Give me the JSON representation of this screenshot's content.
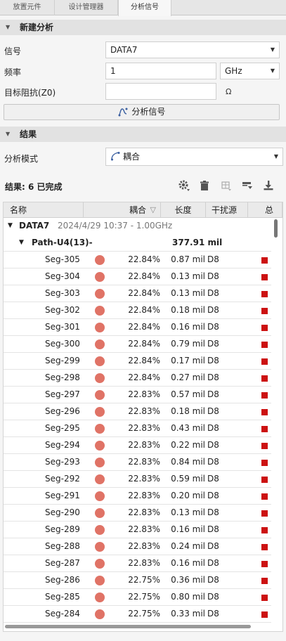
{
  "tabs": [
    "放置元件",
    "设计管理器",
    "分析信号"
  ],
  "new_analysis": {
    "header": "新建分析",
    "signal_label": "信号",
    "signal_value": "DATA7",
    "freq_label": "频率",
    "freq_value": "1",
    "freq_unit": "GHz",
    "impedance_label": "目标阻抗(Z0)",
    "impedance_value": "",
    "impedance_unit": "Ω",
    "analyze_button": "分析信号"
  },
  "results_section": {
    "header": "结果",
    "mode_label": "分析模式",
    "mode_value": "耦合",
    "summary": "结果: 6 已完成"
  },
  "grid": {
    "columns": [
      "名称",
      "耦合",
      "长度",
      "干扰源",
      "总"
    ],
    "group": {
      "name": "DATA7",
      "meta": "2024/4/29 10:37 - 1.00GHz"
    },
    "path": {
      "name": "Path-U4(13)-",
      "length": "377.91 mil"
    },
    "rows": [
      {
        "name": "Seg-305",
        "coupling": "22.84%",
        "length": "0.87 mil",
        "aggressor": "D8"
      },
      {
        "name": "Seg-304",
        "coupling": "22.84%",
        "length": "0.13 mil",
        "aggressor": "D8"
      },
      {
        "name": "Seg-303",
        "coupling": "22.84%",
        "length": "0.13 mil",
        "aggressor": "D8"
      },
      {
        "name": "Seg-302",
        "coupling": "22.84%",
        "length": "0.18 mil",
        "aggressor": "D8"
      },
      {
        "name": "Seg-301",
        "coupling": "22.84%",
        "length": "0.16 mil",
        "aggressor": "D8"
      },
      {
        "name": "Seg-300",
        "coupling": "22.84%",
        "length": "0.79 mil",
        "aggressor": "D8"
      },
      {
        "name": "Seg-299",
        "coupling": "22.84%",
        "length": "0.17 mil",
        "aggressor": "D8"
      },
      {
        "name": "Seg-298",
        "coupling": "22.84%",
        "length": "0.27 mil",
        "aggressor": "D8"
      },
      {
        "name": "Seg-297",
        "coupling": "22.83%",
        "length": "0.57 mil",
        "aggressor": "D8"
      },
      {
        "name": "Seg-296",
        "coupling": "22.83%",
        "length": "0.18 mil",
        "aggressor": "D8"
      },
      {
        "name": "Seg-295",
        "coupling": "22.83%",
        "length": "0.43 mil",
        "aggressor": "D8"
      },
      {
        "name": "Seg-294",
        "coupling": "22.83%",
        "length": "0.22 mil",
        "aggressor": "D8"
      },
      {
        "name": "Seg-293",
        "coupling": "22.83%",
        "length": "0.84 mil",
        "aggressor": "D8"
      },
      {
        "name": "Seg-292",
        "coupling": "22.83%",
        "length": "0.59 mil",
        "aggressor": "D8"
      },
      {
        "name": "Seg-291",
        "coupling": "22.83%",
        "length": "0.20 mil",
        "aggressor": "D8"
      },
      {
        "name": "Seg-290",
        "coupling": "22.83%",
        "length": "0.13 mil",
        "aggressor": "D8"
      },
      {
        "name": "Seg-289",
        "coupling": "22.83%",
        "length": "0.16 mil",
        "aggressor": "D8"
      },
      {
        "name": "Seg-288",
        "coupling": "22.83%",
        "length": "0.24 mil",
        "aggressor": "D8"
      },
      {
        "name": "Seg-287",
        "coupling": "22.83%",
        "length": "0.16 mil",
        "aggressor": "D8"
      },
      {
        "name": "Seg-286",
        "coupling": "22.75%",
        "length": "0.36 mil",
        "aggressor": "D8"
      },
      {
        "name": "Seg-285",
        "coupling": "22.75%",
        "length": "0.80 mil",
        "aggressor": "D8"
      },
      {
        "name": "Seg-284",
        "coupling": "22.75%",
        "length": "0.33 mil",
        "aggressor": "D8"
      }
    ]
  },
  "icons": [
    "gear-icon",
    "trash-icon",
    "table-icon",
    "export-icon",
    "download-icon",
    "signal-icon",
    "coupling-icon",
    "dropdown-icon"
  ]
}
